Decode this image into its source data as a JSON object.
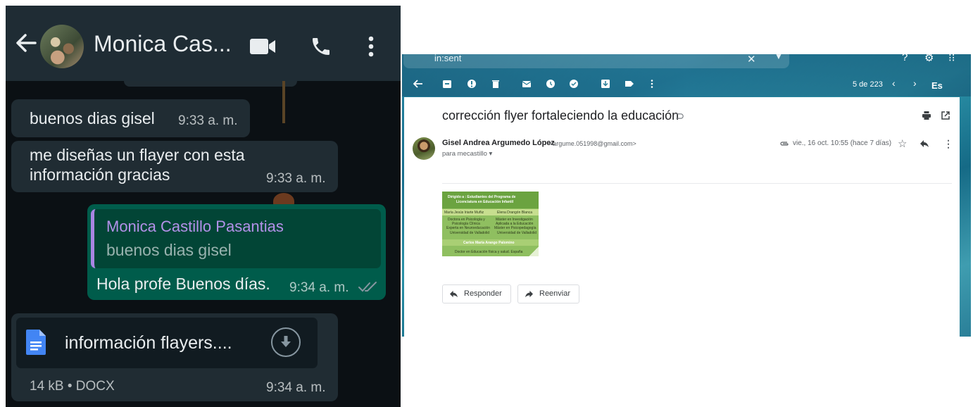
{
  "whatsapp": {
    "contact_name": "Monica Cas...",
    "messages": [
      {
        "text": "buenos dias gisel",
        "time": "9:33 a. m."
      },
      {
        "text_line1": "me diseñas un flayer con esta",
        "text_line2": "información gracias",
        "time": "9:33 a. m."
      },
      {
        "quoted_author": "Monica Castillo Pasantias",
        "quoted_text": "buenos dias gisel",
        "text": "Hola profe Buenos días.",
        "time": "9:34 a. m."
      },
      {
        "doc_name": "información flayers....",
        "doc_meta": "14 kB • DOCX",
        "time": "9:34 a. m."
      }
    ],
    "colors": {
      "header": "#1f2c34",
      "incoming": "#202c33",
      "outgoing": "#005c4b",
      "background": "#0b1014"
    }
  },
  "gmail": {
    "search_text": "in:sent",
    "count": "5 de 223",
    "lang": "Es",
    "subject": "corrección flyer fortaleciendo la educación",
    "sender_name": "Gisel Andrea Argumedo López",
    "sender_email": "<argume.051998@gmail.com>",
    "to": "para mecastillo",
    "date": "vie., 16 oct. 10:55 (hace 7 días)",
    "reply_label": "Responder",
    "forward_label": "Reenviar",
    "flyer": {
      "title_line1": "Dirigido a : Estudiantes del Programa de",
      "title_line2": "Licenciatura en Educación Infantil",
      "name_left": "María Jesús Iriarte Muñiz",
      "name_right": "Elena Drangón Blanca",
      "left_line1": "Doctora en Psicología y",
      "left_line2": "Psicología Clínica",
      "left_line3": "Experta en Neuroeducación",
      "left_univ": "Universidad de Valladolid",
      "right_line1": "Máster en Investigación",
      "right_line2": "Aplicada a la Educación",
      "right_line3": "Máster en Psicopedagogía",
      "right_univ": "Universidad de Valladolid",
      "name_bottom": "Carlos María Arango Palomino",
      "bottom_line": "Doctor en Educación física y salud. España"
    }
  }
}
